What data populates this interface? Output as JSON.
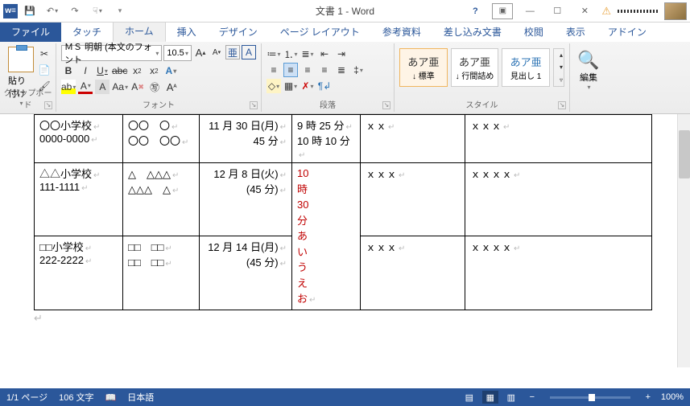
{
  "title": "文書 1 - Word",
  "qat": {
    "undo": "↶",
    "redo": "↷",
    "touch": "☟"
  },
  "tabs": [
    "ファイル",
    "タッチ",
    "ホーム",
    "挿入",
    "デザイン",
    "ページ レイアウト",
    "参考資料",
    "差し込み文書",
    "校閲",
    "表示",
    "アドイン"
  ],
  "active_tab": 2,
  "ribbon": {
    "clipboard": {
      "label": "クリップボード",
      "paste": "貼り付け"
    },
    "font": {
      "label": "フォント",
      "name": "ＭＳ 明朝 (本文のフォント",
      "size": "10.5",
      "grow": "A",
      "shrink": "A",
      "case": "Aa",
      "clear": "A",
      "phonetic": "亜",
      "charborder": "A"
    },
    "para": {
      "label": "段落"
    },
    "styles": {
      "label": "スタイル",
      "items": [
        {
          "prev": "あア亜",
          "name": "↓ 標準"
        },
        {
          "prev": "あア亜",
          "name": "↓ 行間詰め"
        },
        {
          "prev": "あア亜",
          "name": "見出し 1"
        }
      ]
    },
    "edit": {
      "label": "編集"
    }
  },
  "table": {
    "rows": [
      {
        "c1a": "〇〇小学校",
        "c1b": "0000-0000",
        "c2a": "〇〇　〇",
        "c2b": "〇〇　〇〇",
        "c3a": "11 月 30 日(月)",
        "c3b": "45 分",
        "c4a": "9 時 25 分",
        "c4b": "10 時 10 分",
        "c5": "ｘｘ",
        "c6": "ｘｘｘ"
      },
      {
        "c1a": "△△小学校",
        "c1b": "111-1111",
        "c2a": "△　△△△",
        "c2b": "△△△　△",
        "c3a": "12 月 8 日(火)",
        "c3b": "(45 分)",
        "c4_lines": [
          "10",
          "時",
          "30",
          "分",
          "あ",
          "い",
          "う",
          "え",
          "お"
        ],
        "c5": "ｘｘｘ",
        "c6": "ｘｘｘｘ"
      },
      {
        "c1a": "□□小学校",
        "c1b": "222-2222",
        "c2a": "□□　□□",
        "c2b": "□□　□□",
        "c3a": "12 月 14 日(月)",
        "c3b": "(45 分)",
        "c5": "ｘｘｘ",
        "c6": "ｘｘｘｘ"
      }
    ]
  },
  "status": {
    "page": "1/1 ページ",
    "words": "106 文字",
    "lang": "日本語",
    "zoom": "100%"
  }
}
